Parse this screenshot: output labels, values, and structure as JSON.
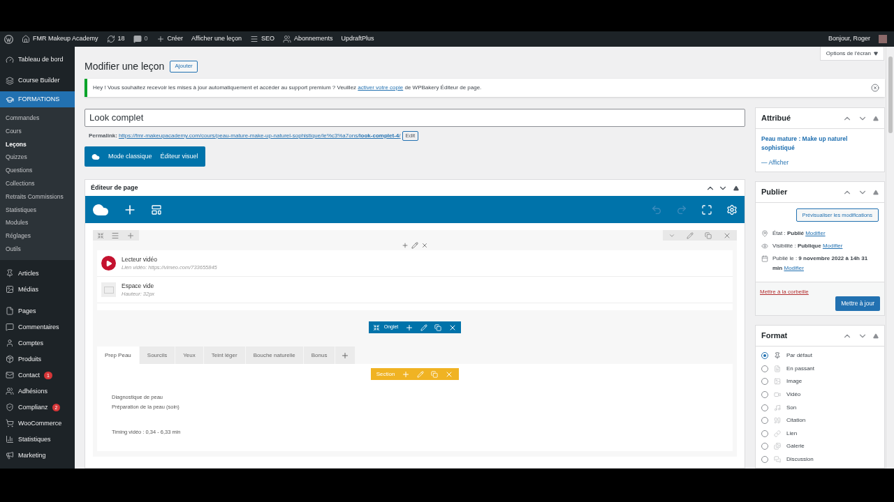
{
  "admin_bar": {
    "site": "FMR Makeup Academy",
    "updates": "18",
    "comments": "0",
    "items": [
      {
        "label": "Créer"
      },
      {
        "label": "Afficher une leçon"
      },
      {
        "label": "SEO"
      },
      {
        "label": "Abonnements"
      },
      {
        "label": "UpdraftPlus"
      }
    ],
    "greeting": "Bonjour, Roger"
  },
  "sidebar": {
    "items": [
      {
        "label": "Tableau de bord",
        "selected": false
      },
      {
        "label": "Course Builder",
        "selected": false
      },
      {
        "label": "FORMATIONS",
        "selected": true,
        "children": [
          {
            "label": "Commandes",
            "selected": false
          },
          {
            "label": "Cours",
            "selected": false
          },
          {
            "label": "Leçons",
            "selected": true
          },
          {
            "label": "Quizzes",
            "selected": false
          },
          {
            "label": "Questions",
            "selected": false
          },
          {
            "label": "Collections",
            "selected": false
          },
          {
            "label": "Retraits Commissions",
            "selected": false
          },
          {
            "label": "Statistiques",
            "selected": false
          },
          {
            "label": "Modules",
            "selected": false
          },
          {
            "label": "Réglages",
            "selected": false
          },
          {
            "label": "Outils",
            "selected": false
          }
        ]
      },
      {
        "label": "Articles",
        "selected": false
      },
      {
        "label": "Médias",
        "selected": false
      },
      {
        "label": "Pages",
        "selected": false
      },
      {
        "label": "Commentaires",
        "selected": false
      },
      {
        "label": "Comptes",
        "selected": false
      },
      {
        "label": "Produits",
        "selected": false
      },
      {
        "label": "Contact",
        "selected": false,
        "badge": "1"
      },
      {
        "label": "Adhésions",
        "selected": false
      },
      {
        "label": "Complianz",
        "selected": false,
        "badge": "2"
      },
      {
        "label": "WooCommerce",
        "selected": false
      },
      {
        "label": "Statistiques",
        "selected": false
      },
      {
        "label": "Marketing",
        "selected": false
      }
    ]
  },
  "header": {
    "title": "Modifier une leçon",
    "add_button": "Ajouter",
    "screen_options": "Options de l'écran"
  },
  "notice": {
    "text": "Hey ! Vous souhaitez recevoir les mises à jour automatiquement et accéder au support premium ? Veuillez",
    "link": "activer votre copie",
    "after": "de WPBakery Éditeur de page."
  },
  "post_title": "Look complet",
  "permalink": {
    "label": "Permalink:",
    "url": "https://fmr-makeupacademy.com/cours/peau-mature-make-up-naturel-sophistique/le%c3%a7ons/**look-complet-4**/",
    "edit": "Edit"
  },
  "mode_buttons": [
    "Mode classique",
    "Éditeur visuel"
  ],
  "page_editor": {
    "title": "Éditeur de page",
    "elements": [
      {
        "kind": "video",
        "name": "Lecteur vidéo",
        "detail": "Lien vidéo: https://vimeo.com/733655845"
      },
      {
        "kind": "spacer",
        "name": "Espace vide",
        "detail": "Hauteur: 32px"
      }
    ],
    "tab_control": "Onglet",
    "tabs": [
      {
        "label": "Prep Peau",
        "selected": true
      },
      {
        "label": "Sourcils",
        "selected": false
      },
      {
        "label": "Yeux",
        "selected": false
      },
      {
        "label": "Teint léger",
        "selected": false
      },
      {
        "label": "Bouche naturelle",
        "selected": false
      },
      {
        "label": "Bonus",
        "selected": false
      }
    ],
    "section_label": "Section",
    "lines": [
      "Diagnostique de peau",
      "Préparation de la peau (soin)"
    ],
    "timing": "Timing vidéo : 0,34 - 6,33 min"
  },
  "attribue": {
    "title": "Attribué",
    "link": "Peau mature : Make up naturel sophistiqué",
    "view": "— Afficher"
  },
  "publish": {
    "title": "Publier",
    "preview": "Prévisualiser les modifications",
    "rows": [
      {
        "text": "État : **Publié**",
        "link": "Modifier"
      },
      {
        "text": "Visibilité : **Publique**",
        "link": "Modifier"
      },
      {
        "text": "Publié le : **9 novembre 2022 à 14h 31 min**",
        "link": "Modifier"
      }
    ],
    "trash": "Mettre à la corbeille",
    "update": "Mettre à jour"
  },
  "format": {
    "title": "Format",
    "options": [
      {
        "label": "Par défaut",
        "selected": true
      },
      {
        "label": "En passant",
        "selected": false
      },
      {
        "label": "Image",
        "selected": false
      },
      {
        "label": "Vidéo",
        "selected": false
      },
      {
        "label": "Son",
        "selected": false
      },
      {
        "label": "Citation",
        "selected": false
      },
      {
        "label": "Lien",
        "selected": false
      },
      {
        "label": "Galerie",
        "selected": false
      },
      {
        "label": "Discussion",
        "selected": false
      }
    ]
  }
}
